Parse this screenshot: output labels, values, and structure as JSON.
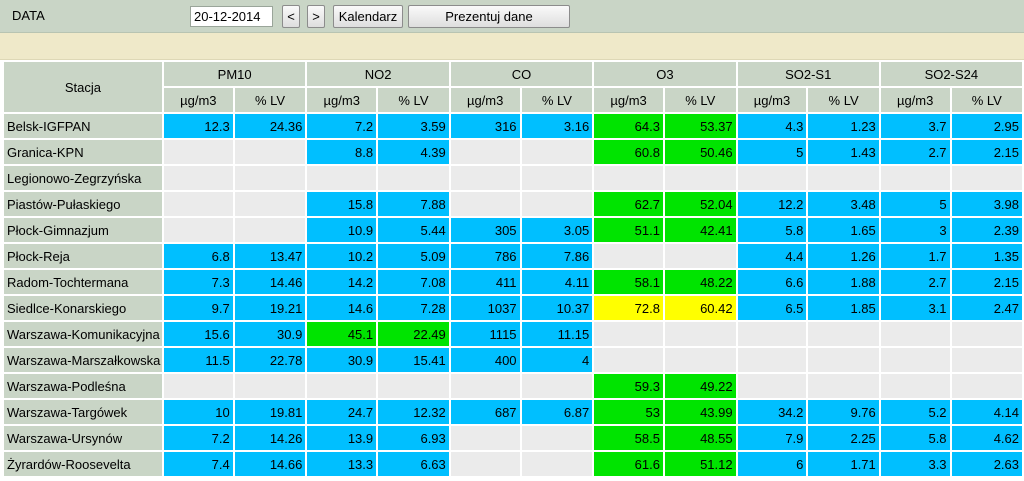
{
  "toolbar": {
    "label": "DATA",
    "date_value": "20-12-2014",
    "prev_label": "<",
    "next_label": ">",
    "calendar_label": "Kalendarz",
    "show_label": "Prezentuj dane"
  },
  "colors": {
    "blue": "#00bfff",
    "green": "#00e400",
    "yellow": "#ffff00",
    "empty": "#ebebeb",
    "header": "#c9d5c6"
  },
  "table": {
    "station_header": "Stacja",
    "pollutants": [
      "PM10",
      "NO2",
      "CO",
      "O3",
      "SO2-S1",
      "SO2-S24"
    ],
    "units": [
      "µg/m3",
      "% LV"
    ],
    "rows": [
      {
        "name": "Belsk-IGFPAN",
        "cells": [
          [
            "12.3",
            "blue"
          ],
          [
            "24.36",
            "blue"
          ],
          [
            "7.2",
            "blue"
          ],
          [
            "3.59",
            "blue"
          ],
          [
            "316",
            "blue"
          ],
          [
            "3.16",
            "blue"
          ],
          [
            "64.3",
            "green"
          ],
          [
            "53.37",
            "green"
          ],
          [
            "4.3",
            "blue"
          ],
          [
            "1.23",
            "blue"
          ],
          [
            "3.7",
            "blue"
          ],
          [
            "2.95",
            "blue"
          ]
        ]
      },
      {
        "name": "Granica-KPN",
        "cells": [
          [
            "",
            ""
          ],
          [
            "",
            ""
          ],
          [
            "8.8",
            "blue"
          ],
          [
            "4.39",
            "blue"
          ],
          [
            "",
            ""
          ],
          [
            "",
            ""
          ],
          [
            "60.8",
            "green"
          ],
          [
            "50.46",
            "green"
          ],
          [
            "5",
            "blue"
          ],
          [
            "1.43",
            "blue"
          ],
          [
            "2.7",
            "blue"
          ],
          [
            "2.15",
            "blue"
          ]
        ]
      },
      {
        "name": "Legionowo-Zegrzyńska",
        "cells": [
          [
            "",
            ""
          ],
          [
            "",
            ""
          ],
          [
            "",
            ""
          ],
          [
            "",
            ""
          ],
          [
            "",
            ""
          ],
          [
            "",
            ""
          ],
          [
            "",
            ""
          ],
          [
            "",
            ""
          ],
          [
            "",
            ""
          ],
          [
            "",
            ""
          ],
          [
            "",
            ""
          ],
          [
            "",
            ""
          ]
        ]
      },
      {
        "name": "Piastów-Pułaskiego",
        "cells": [
          [
            "",
            ""
          ],
          [
            "",
            ""
          ],
          [
            "15.8",
            "blue"
          ],
          [
            "7.88",
            "blue"
          ],
          [
            "",
            ""
          ],
          [
            "",
            ""
          ],
          [
            "62.7",
            "green"
          ],
          [
            "52.04",
            "green"
          ],
          [
            "12.2",
            "blue"
          ],
          [
            "3.48",
            "blue"
          ],
          [
            "5",
            "blue"
          ],
          [
            "3.98",
            "blue"
          ]
        ]
      },
      {
        "name": "Płock-Gimnazjum",
        "cells": [
          [
            "",
            ""
          ],
          [
            "",
            ""
          ],
          [
            "10.9",
            "blue"
          ],
          [
            "5.44",
            "blue"
          ],
          [
            "305",
            "blue"
          ],
          [
            "3.05",
            "blue"
          ],
          [
            "51.1",
            "green"
          ],
          [
            "42.41",
            "green"
          ],
          [
            "5.8",
            "blue"
          ],
          [
            "1.65",
            "blue"
          ],
          [
            "3",
            "blue"
          ],
          [
            "2.39",
            "blue"
          ]
        ]
      },
      {
        "name": "Płock-Reja",
        "cells": [
          [
            "6.8",
            "blue"
          ],
          [
            "13.47",
            "blue"
          ],
          [
            "10.2",
            "blue"
          ],
          [
            "5.09",
            "blue"
          ],
          [
            "786",
            "blue"
          ],
          [
            "7.86",
            "blue"
          ],
          [
            "",
            ""
          ],
          [
            "",
            ""
          ],
          [
            "4.4",
            "blue"
          ],
          [
            "1.26",
            "blue"
          ],
          [
            "1.7",
            "blue"
          ],
          [
            "1.35",
            "blue"
          ]
        ]
      },
      {
        "name": "Radom-Tochtermana",
        "cells": [
          [
            "7.3",
            "blue"
          ],
          [
            "14.46",
            "blue"
          ],
          [
            "14.2",
            "blue"
          ],
          [
            "7.08",
            "blue"
          ],
          [
            "411",
            "blue"
          ],
          [
            "4.11",
            "blue"
          ],
          [
            "58.1",
            "green"
          ],
          [
            "48.22",
            "green"
          ],
          [
            "6.6",
            "blue"
          ],
          [
            "1.88",
            "blue"
          ],
          [
            "2.7",
            "blue"
          ],
          [
            "2.15",
            "blue"
          ]
        ]
      },
      {
        "name": "Siedlce-Konarskiego",
        "cells": [
          [
            "9.7",
            "blue"
          ],
          [
            "19.21",
            "blue"
          ],
          [
            "14.6",
            "blue"
          ],
          [
            "7.28",
            "blue"
          ],
          [
            "1037",
            "blue"
          ],
          [
            "10.37",
            "blue"
          ],
          [
            "72.8",
            "yellow"
          ],
          [
            "60.42",
            "yellow"
          ],
          [
            "6.5",
            "blue"
          ],
          [
            "1.85",
            "blue"
          ],
          [
            "3.1",
            "blue"
          ],
          [
            "2.47",
            "blue"
          ]
        ]
      },
      {
        "name": "Warszawa-Komunikacyjna",
        "cells": [
          [
            "15.6",
            "blue"
          ],
          [
            "30.9",
            "blue"
          ],
          [
            "45.1",
            "green"
          ],
          [
            "22.49",
            "green"
          ],
          [
            "1115",
            "blue"
          ],
          [
            "11.15",
            "blue"
          ],
          [
            "",
            ""
          ],
          [
            "",
            ""
          ],
          [
            "",
            ""
          ],
          [
            "",
            ""
          ],
          [
            "",
            ""
          ],
          [
            "",
            ""
          ]
        ]
      },
      {
        "name": "Warszawa-Marszałkowska",
        "cells": [
          [
            "11.5",
            "blue"
          ],
          [
            "22.78",
            "blue"
          ],
          [
            "30.9",
            "blue"
          ],
          [
            "15.41",
            "blue"
          ],
          [
            "400",
            "blue"
          ],
          [
            "4",
            "blue"
          ],
          [
            "",
            ""
          ],
          [
            "",
            ""
          ],
          [
            "",
            ""
          ],
          [
            "",
            ""
          ],
          [
            "",
            ""
          ],
          [
            "",
            ""
          ]
        ]
      },
      {
        "name": "Warszawa-Podleśna",
        "cells": [
          [
            "",
            ""
          ],
          [
            "",
            ""
          ],
          [
            "",
            ""
          ],
          [
            "",
            ""
          ],
          [
            "",
            ""
          ],
          [
            "",
            ""
          ],
          [
            "59.3",
            "green"
          ],
          [
            "49.22",
            "green"
          ],
          [
            "",
            ""
          ],
          [
            "",
            ""
          ],
          [
            "",
            ""
          ],
          [
            "",
            ""
          ]
        ]
      },
      {
        "name": "Warszawa-Targówek",
        "cells": [
          [
            "10",
            "blue"
          ],
          [
            "19.81",
            "blue"
          ],
          [
            "24.7",
            "blue"
          ],
          [
            "12.32",
            "blue"
          ],
          [
            "687",
            "blue"
          ],
          [
            "6.87",
            "blue"
          ],
          [
            "53",
            "green"
          ],
          [
            "43.99",
            "green"
          ],
          [
            "34.2",
            "blue"
          ],
          [
            "9.76",
            "blue"
          ],
          [
            "5.2",
            "blue"
          ],
          [
            "4.14",
            "blue"
          ]
        ]
      },
      {
        "name": "Warszawa-Ursynów",
        "cells": [
          [
            "7.2",
            "blue"
          ],
          [
            "14.26",
            "blue"
          ],
          [
            "13.9",
            "blue"
          ],
          [
            "6.93",
            "blue"
          ],
          [
            "",
            ""
          ],
          [
            "",
            ""
          ],
          [
            "58.5",
            "green"
          ],
          [
            "48.55",
            "green"
          ],
          [
            "7.9",
            "blue"
          ],
          [
            "2.25",
            "blue"
          ],
          [
            "5.8",
            "blue"
          ],
          [
            "4.62",
            "blue"
          ]
        ]
      },
      {
        "name": "Żyrardów-Roosevelta",
        "cells": [
          [
            "7.4",
            "blue"
          ],
          [
            "14.66",
            "blue"
          ],
          [
            "13.3",
            "blue"
          ],
          [
            "6.63",
            "blue"
          ],
          [
            "",
            ""
          ],
          [
            "",
            ""
          ],
          [
            "61.6",
            "green"
          ],
          [
            "51.12",
            "green"
          ],
          [
            "6",
            "blue"
          ],
          [
            "1.71",
            "blue"
          ],
          [
            "3.3",
            "blue"
          ],
          [
            "2.63",
            "blue"
          ]
        ]
      }
    ]
  }
}
